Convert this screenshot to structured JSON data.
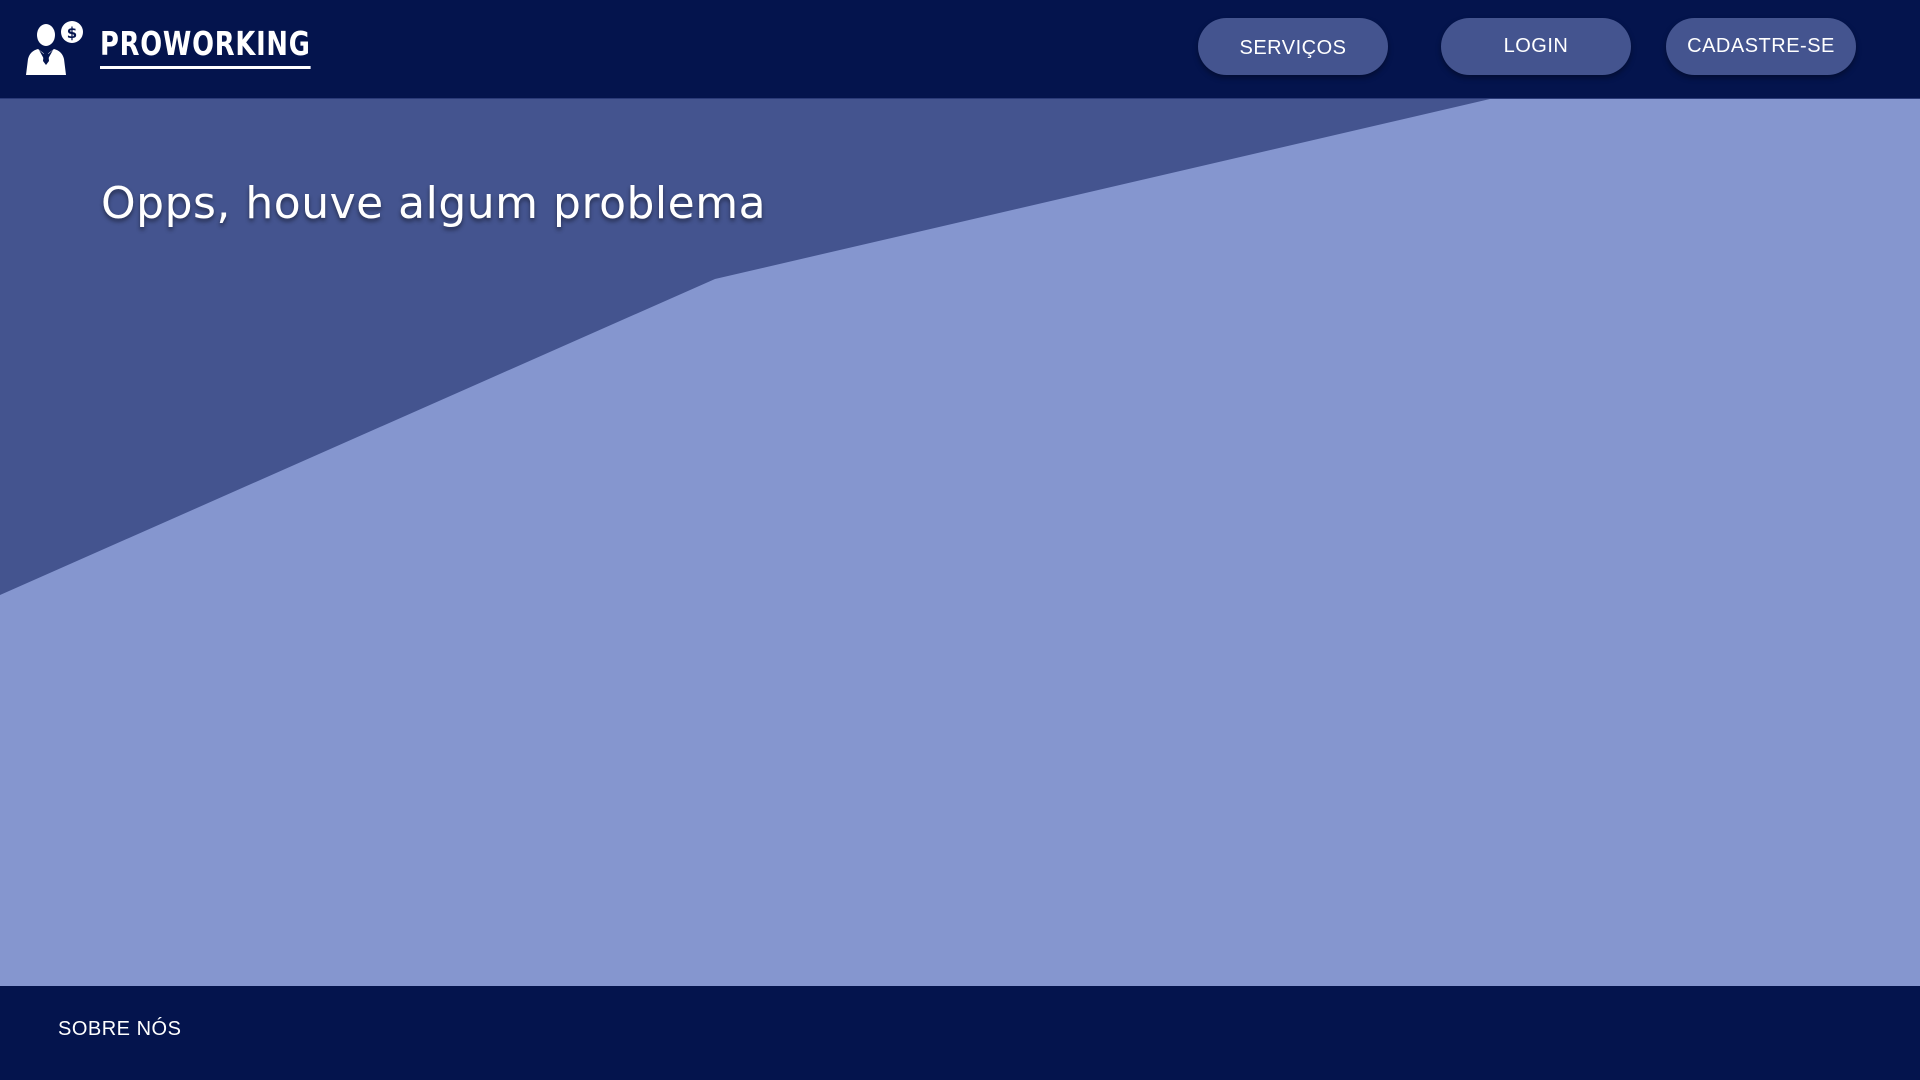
{
  "header": {
    "brand": "PROWORKING",
    "logo_icon": "person-with-dollar-coin-icon",
    "nav": {
      "services_label": "SERVIÇOS",
      "login_label": "LOGIN",
      "signup_label": "CADASTRE-SE"
    }
  },
  "main": {
    "title": "Opps, houve algum problema"
  },
  "footer": {
    "about_label": "SOBRE NÓS"
  },
  "colors": {
    "header_bg": "#04144d",
    "button_bg": "#44548f",
    "hero_dark": "#44548f",
    "hero_light": "#8596cf",
    "footer_bg": "#04144d",
    "text": "#ffffff"
  }
}
